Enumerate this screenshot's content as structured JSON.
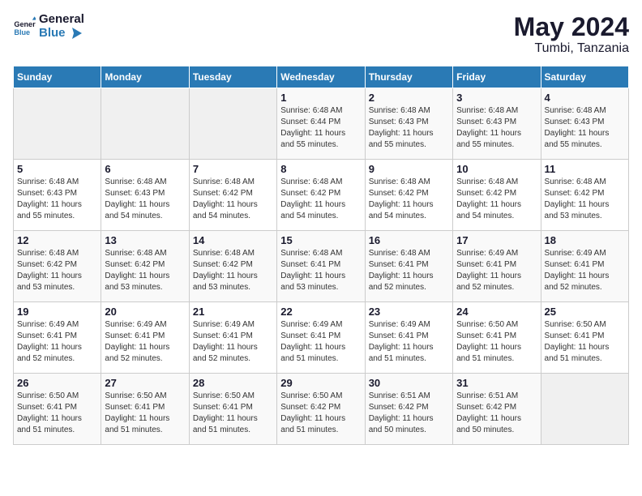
{
  "header": {
    "logo_line1": "General",
    "logo_line2": "Blue",
    "month": "May 2024",
    "location": "Tumbi, Tanzania"
  },
  "weekdays": [
    "Sunday",
    "Monday",
    "Tuesday",
    "Wednesday",
    "Thursday",
    "Friday",
    "Saturday"
  ],
  "weeks": [
    [
      {
        "day": "",
        "info": ""
      },
      {
        "day": "",
        "info": ""
      },
      {
        "day": "",
        "info": ""
      },
      {
        "day": "1",
        "info": "Sunrise: 6:48 AM\nSunset: 6:44 PM\nDaylight: 11 hours\nand 55 minutes."
      },
      {
        "day": "2",
        "info": "Sunrise: 6:48 AM\nSunset: 6:43 PM\nDaylight: 11 hours\nand 55 minutes."
      },
      {
        "day": "3",
        "info": "Sunrise: 6:48 AM\nSunset: 6:43 PM\nDaylight: 11 hours\nand 55 minutes."
      },
      {
        "day": "4",
        "info": "Sunrise: 6:48 AM\nSunset: 6:43 PM\nDaylight: 11 hours\nand 55 minutes."
      }
    ],
    [
      {
        "day": "5",
        "info": "Sunrise: 6:48 AM\nSunset: 6:43 PM\nDaylight: 11 hours\nand 55 minutes."
      },
      {
        "day": "6",
        "info": "Sunrise: 6:48 AM\nSunset: 6:43 PM\nDaylight: 11 hours\nand 54 minutes."
      },
      {
        "day": "7",
        "info": "Sunrise: 6:48 AM\nSunset: 6:42 PM\nDaylight: 11 hours\nand 54 minutes."
      },
      {
        "day": "8",
        "info": "Sunrise: 6:48 AM\nSunset: 6:42 PM\nDaylight: 11 hours\nand 54 minutes."
      },
      {
        "day": "9",
        "info": "Sunrise: 6:48 AM\nSunset: 6:42 PM\nDaylight: 11 hours\nand 54 minutes."
      },
      {
        "day": "10",
        "info": "Sunrise: 6:48 AM\nSunset: 6:42 PM\nDaylight: 11 hours\nand 54 minutes."
      },
      {
        "day": "11",
        "info": "Sunrise: 6:48 AM\nSunset: 6:42 PM\nDaylight: 11 hours\nand 53 minutes."
      }
    ],
    [
      {
        "day": "12",
        "info": "Sunrise: 6:48 AM\nSunset: 6:42 PM\nDaylight: 11 hours\nand 53 minutes."
      },
      {
        "day": "13",
        "info": "Sunrise: 6:48 AM\nSunset: 6:42 PM\nDaylight: 11 hours\nand 53 minutes."
      },
      {
        "day": "14",
        "info": "Sunrise: 6:48 AM\nSunset: 6:42 PM\nDaylight: 11 hours\nand 53 minutes."
      },
      {
        "day": "15",
        "info": "Sunrise: 6:48 AM\nSunset: 6:41 PM\nDaylight: 11 hours\nand 53 minutes."
      },
      {
        "day": "16",
        "info": "Sunrise: 6:48 AM\nSunset: 6:41 PM\nDaylight: 11 hours\nand 52 minutes."
      },
      {
        "day": "17",
        "info": "Sunrise: 6:49 AM\nSunset: 6:41 PM\nDaylight: 11 hours\nand 52 minutes."
      },
      {
        "day": "18",
        "info": "Sunrise: 6:49 AM\nSunset: 6:41 PM\nDaylight: 11 hours\nand 52 minutes."
      }
    ],
    [
      {
        "day": "19",
        "info": "Sunrise: 6:49 AM\nSunset: 6:41 PM\nDaylight: 11 hours\nand 52 minutes."
      },
      {
        "day": "20",
        "info": "Sunrise: 6:49 AM\nSunset: 6:41 PM\nDaylight: 11 hours\nand 52 minutes."
      },
      {
        "day": "21",
        "info": "Sunrise: 6:49 AM\nSunset: 6:41 PM\nDaylight: 11 hours\nand 52 minutes."
      },
      {
        "day": "22",
        "info": "Sunrise: 6:49 AM\nSunset: 6:41 PM\nDaylight: 11 hours\nand 51 minutes."
      },
      {
        "day": "23",
        "info": "Sunrise: 6:49 AM\nSunset: 6:41 PM\nDaylight: 11 hours\nand 51 minutes."
      },
      {
        "day": "24",
        "info": "Sunrise: 6:50 AM\nSunset: 6:41 PM\nDaylight: 11 hours\nand 51 minutes."
      },
      {
        "day": "25",
        "info": "Sunrise: 6:50 AM\nSunset: 6:41 PM\nDaylight: 11 hours\nand 51 minutes."
      }
    ],
    [
      {
        "day": "26",
        "info": "Sunrise: 6:50 AM\nSunset: 6:41 PM\nDaylight: 11 hours\nand 51 minutes."
      },
      {
        "day": "27",
        "info": "Sunrise: 6:50 AM\nSunset: 6:41 PM\nDaylight: 11 hours\nand 51 minutes."
      },
      {
        "day": "28",
        "info": "Sunrise: 6:50 AM\nSunset: 6:41 PM\nDaylight: 11 hours\nand 51 minutes."
      },
      {
        "day": "29",
        "info": "Sunrise: 6:50 AM\nSunset: 6:42 PM\nDaylight: 11 hours\nand 51 minutes."
      },
      {
        "day": "30",
        "info": "Sunrise: 6:51 AM\nSunset: 6:42 PM\nDaylight: 11 hours\nand 50 minutes."
      },
      {
        "day": "31",
        "info": "Sunrise: 6:51 AM\nSunset: 6:42 PM\nDaylight: 11 hours\nand 50 minutes."
      },
      {
        "day": "",
        "info": ""
      }
    ]
  ]
}
